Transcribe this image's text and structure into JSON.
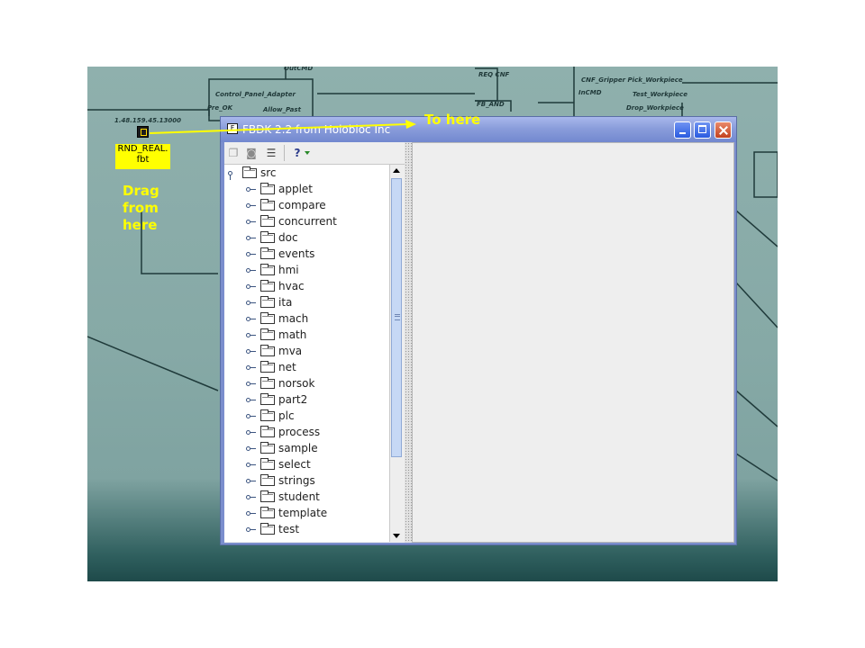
{
  "window": {
    "title": "FBDK 2.2 from Holobloc Inc",
    "app_icon": "fbdk-app-icon",
    "controls": [
      "minimize",
      "maximize",
      "close"
    ]
  },
  "toolbar": {
    "buttons": [
      "copy-icon",
      "binoculars-icon",
      "list-icon",
      "help-icon"
    ]
  },
  "tree": {
    "root": "src",
    "items": [
      "applet",
      "compare",
      "concurrent",
      "doc",
      "events",
      "hmi",
      "hvac",
      "ita",
      "mach",
      "math",
      "mva",
      "net",
      "norsok",
      "part2",
      "plc",
      "process",
      "sample",
      "select",
      "strings",
      "student",
      "template",
      "test"
    ]
  },
  "drag_item": {
    "label_line1": "RND_REAL.",
    "label_line2": "fbt"
  },
  "annotations": {
    "to_here": "To here",
    "drag_line1": "Drag",
    "drag_line2": "from",
    "drag_line3": "here"
  },
  "background_labels": [
    "OutCMD",
    "Control_Panel_Adapter",
    "Pre_OK",
    "Allow_Past",
    "REQ CNF",
    "FB_AND",
    "CNF_Gripper Pick_Workpiece",
    "InCMD",
    "Test_Workpiece",
    "Drop_Workpiece",
    "1.48.159.45.13000"
  ],
  "colors": {
    "annotation": "#ffff00",
    "title_bar": "#8a9ddb",
    "desktop": "#8aacaa"
  }
}
